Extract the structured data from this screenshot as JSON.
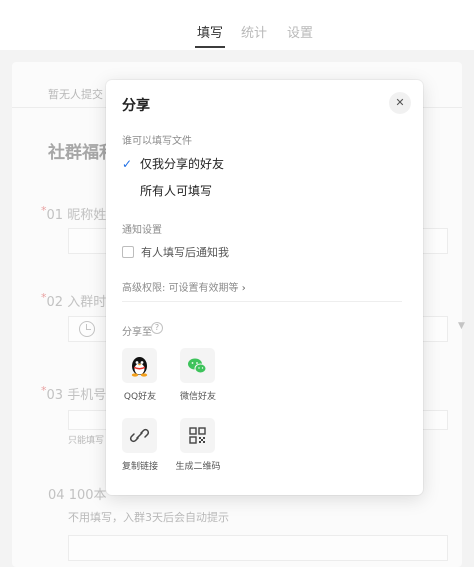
{
  "tabs": [
    {
      "label": "填写",
      "active": true
    },
    {
      "label": "统计",
      "active": false
    },
    {
      "label": "设置",
      "active": false
    }
  ],
  "background_form": {
    "status_text": "暂无人提交",
    "title": "社群福利",
    "questions": [
      {
        "number": "01",
        "label": "昵称姓",
        "required": true
      },
      {
        "number": "02",
        "label": "入群时",
        "required": true
      },
      {
        "number": "03",
        "label": "手机号",
        "required": true
      },
      {
        "number": "04",
        "label": "100本",
        "required": false
      }
    ],
    "q3_hint": "只能填写",
    "q4_hint": "不用填写，入群3天后会自动提示"
  },
  "modal": {
    "title": "分享",
    "close_icon": "close-icon",
    "who_can_fill_label": "谁可以填写文件",
    "options": [
      {
        "label": "仅我分享的好友",
        "selected": true
      },
      {
        "label": "所有人可填写",
        "selected": false
      }
    ],
    "notify_label": "通知设置",
    "notify_checkbox": {
      "label": "有人填写后通知我",
      "checked": false
    },
    "advanced_link": "高级权限: 可设置有效期等",
    "share_to_label": "分享至",
    "share_targets": [
      {
        "label": "QQ好友",
        "icon": "qq-icon"
      },
      {
        "label": "微信好友",
        "icon": "wechat-icon"
      },
      {
        "label": "复制链接",
        "icon": "link-icon"
      },
      {
        "label": "生成二维码",
        "icon": "qrcode-icon"
      }
    ]
  },
  "colors": {
    "accent": "#1f6fe5",
    "wechat_green": "#3dc35b",
    "required_star": "#e05555"
  }
}
